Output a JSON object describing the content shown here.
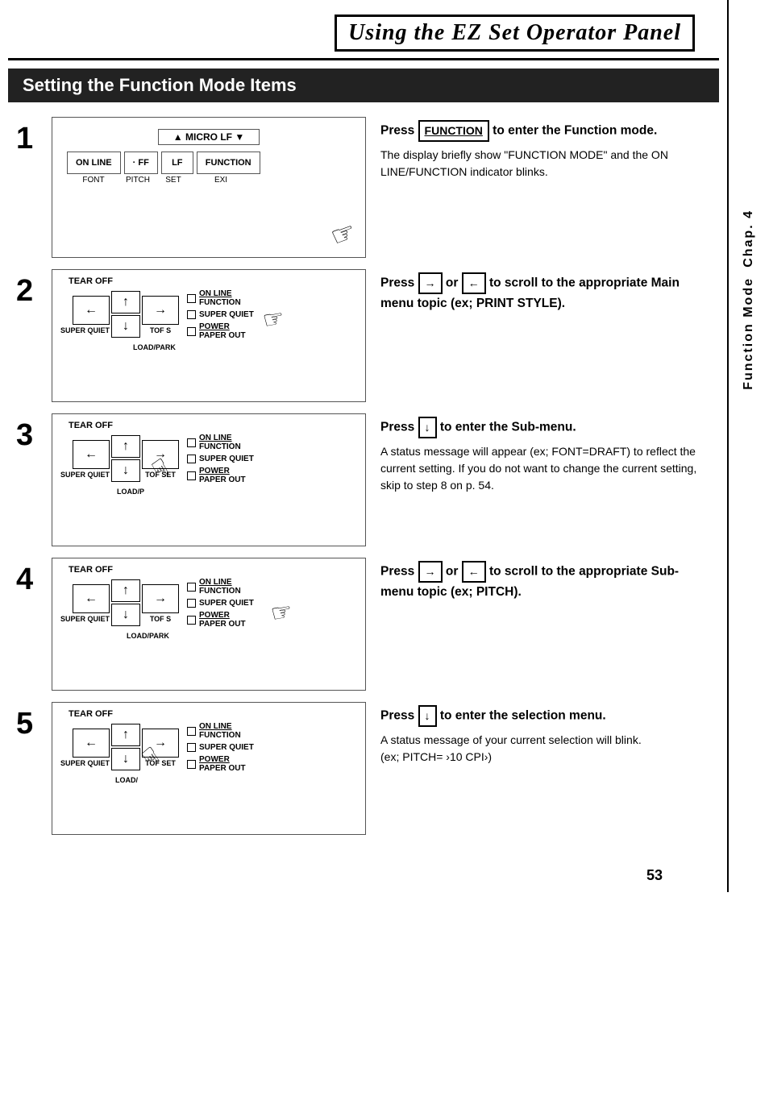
{
  "header": {
    "title": "Using the EZ Set Operator Panel"
  },
  "section": {
    "title": "Setting the Function Mode Items"
  },
  "sidebar": {
    "chap": "Chap. 4",
    "func": "Function Mode"
  },
  "page_number": "53",
  "steps": [
    {
      "number": "1",
      "press_line": "Press  FUNCTION  to enter the Function mode.",
      "desc": "The display briefly show \"FUNCTION MODE\" and the ON LINE/FUNCTION indicator blinks.",
      "key": "FUNCTION"
    },
    {
      "number": "2",
      "press_line": "Press  →  or  ←  to scroll to the appropriate Main menu topic (ex; PRINT STYLE).",
      "desc": ""
    },
    {
      "number": "3",
      "press_line": "Press  ↓  to enter the Sub-menu.",
      "desc": "A status message will appear (ex; FONT=DRAFT) to reflect the current setting. If you do not want to change the current setting, skip to step 8 on p. 54."
    },
    {
      "number": "4",
      "press_line": "Press  →  or  ←  to scroll to the appropriate Sub-menu topic (ex;  PITCH).",
      "desc": ""
    },
    {
      "number": "5",
      "press_line": "Press  ↓  to enter the selection menu.",
      "desc": "A status message of your current selection will blink.\n(ex;  PITCH= 10 CPI)"
    }
  ],
  "labels": {
    "on_line": "ON LINE",
    "ff": "· FF",
    "lf": "LF",
    "function": "FUNCTION",
    "font": "FONT",
    "pitch": "PITCH",
    "set": "SET",
    "exi": "EXI",
    "micro_lf": "▲ MICRO LF ▼",
    "tear_off": "TEAR OFF",
    "super_quiet": "SUPER QUIET",
    "load_park": "LOAD/PARK",
    "tof_set": "TOF SET",
    "on_line_function": "ON LINE\nFUNCTION",
    "super_quiet2": "SUPER QUIET",
    "power_paper_out": "POWER\nPAPER OUT"
  }
}
